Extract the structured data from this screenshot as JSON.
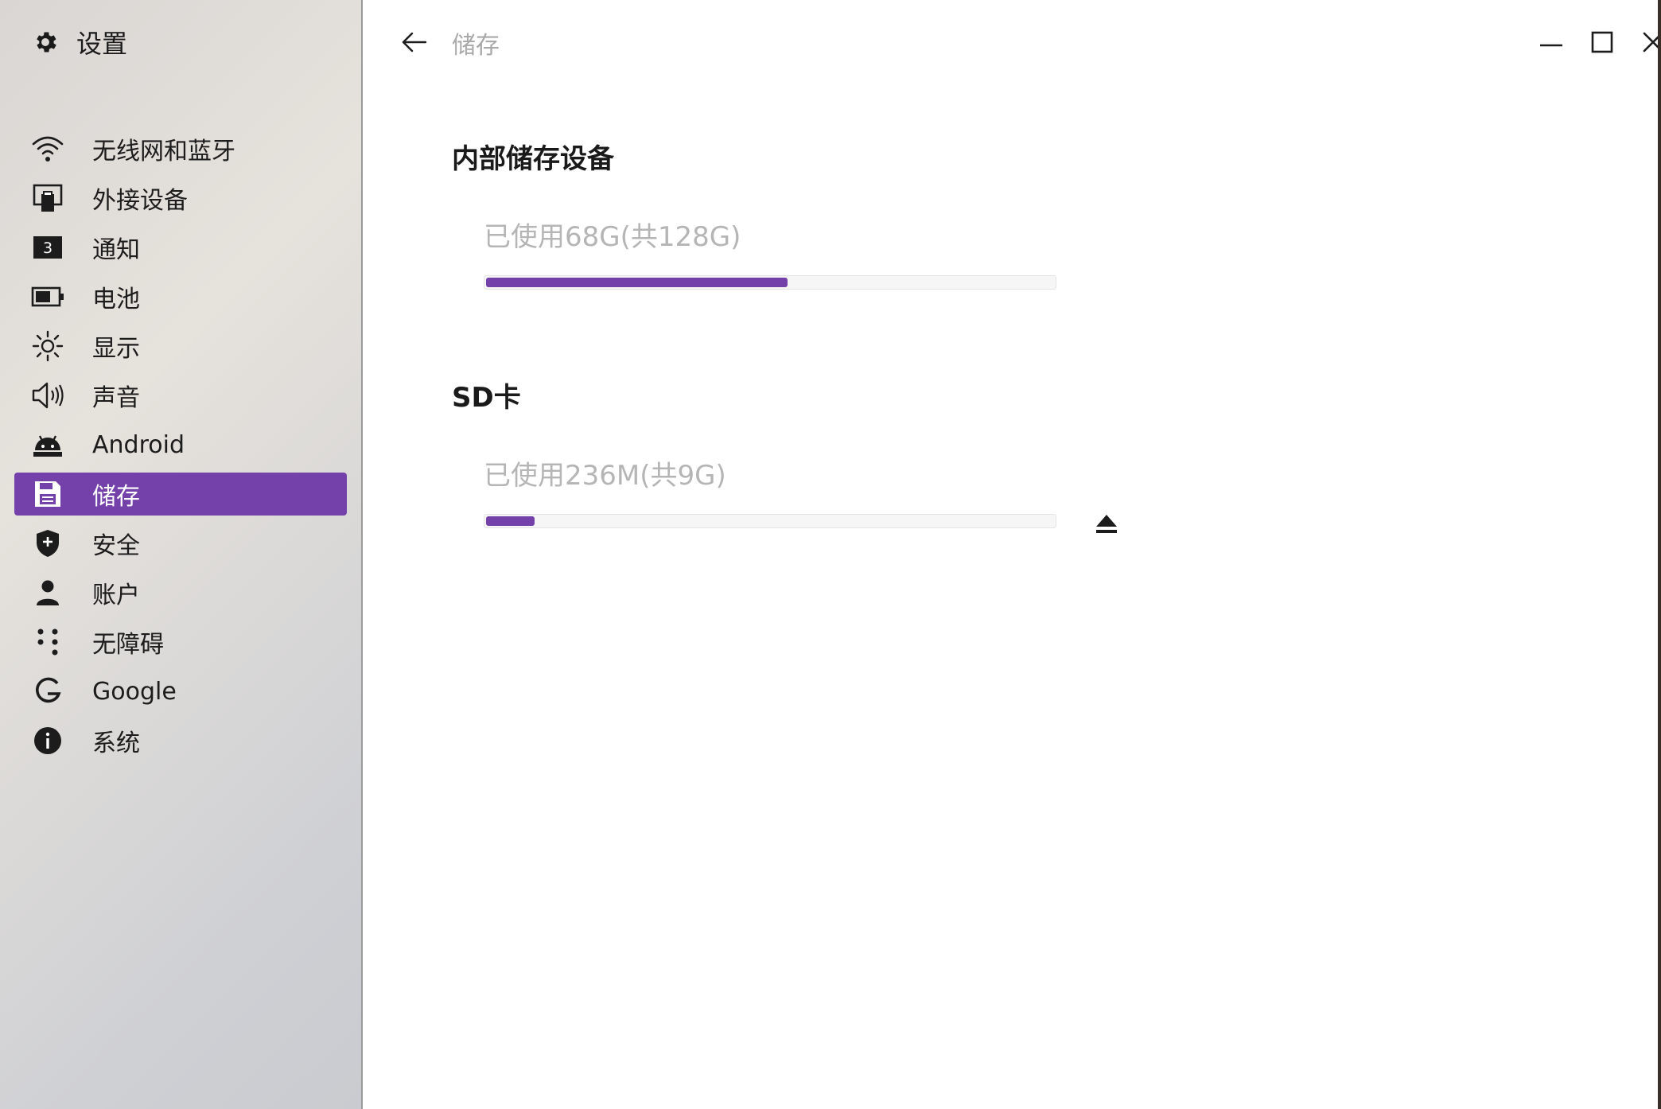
{
  "app": {
    "title": "设置"
  },
  "sidebar": {
    "items": [
      {
        "label": "无线网和蓝牙",
        "icon": "wifi-icon"
      },
      {
        "label": "外接设备",
        "icon": "external-device-icon"
      },
      {
        "label": "通知",
        "icon": "notification-badge-icon",
        "badge": "3"
      },
      {
        "label": "电池",
        "icon": "battery-icon"
      },
      {
        "label": "显示",
        "icon": "brightness-icon"
      },
      {
        "label": "声音",
        "icon": "speaker-icon"
      },
      {
        "label": "Android",
        "icon": "android-icon"
      },
      {
        "label": "储存",
        "icon": "floppy-disk-icon",
        "active": true
      },
      {
        "label": "安全",
        "icon": "shield-icon"
      },
      {
        "label": "账户",
        "icon": "person-icon"
      },
      {
        "label": "无障碍",
        "icon": "accessibility-dots-icon"
      },
      {
        "label": "Google",
        "icon": "google-icon"
      },
      {
        "label": "系统",
        "icon": "info-icon"
      }
    ]
  },
  "header": {
    "title": "储存"
  },
  "internal": {
    "title": "内部储存设备",
    "usage": "已使用68G(共128G)",
    "used_fraction": 0.53
  },
  "sd": {
    "title": "SD卡",
    "usage": "已使用236M(共9G)",
    "used_fraction": 0.085
  },
  "colors": {
    "accent": "#7440a9"
  }
}
